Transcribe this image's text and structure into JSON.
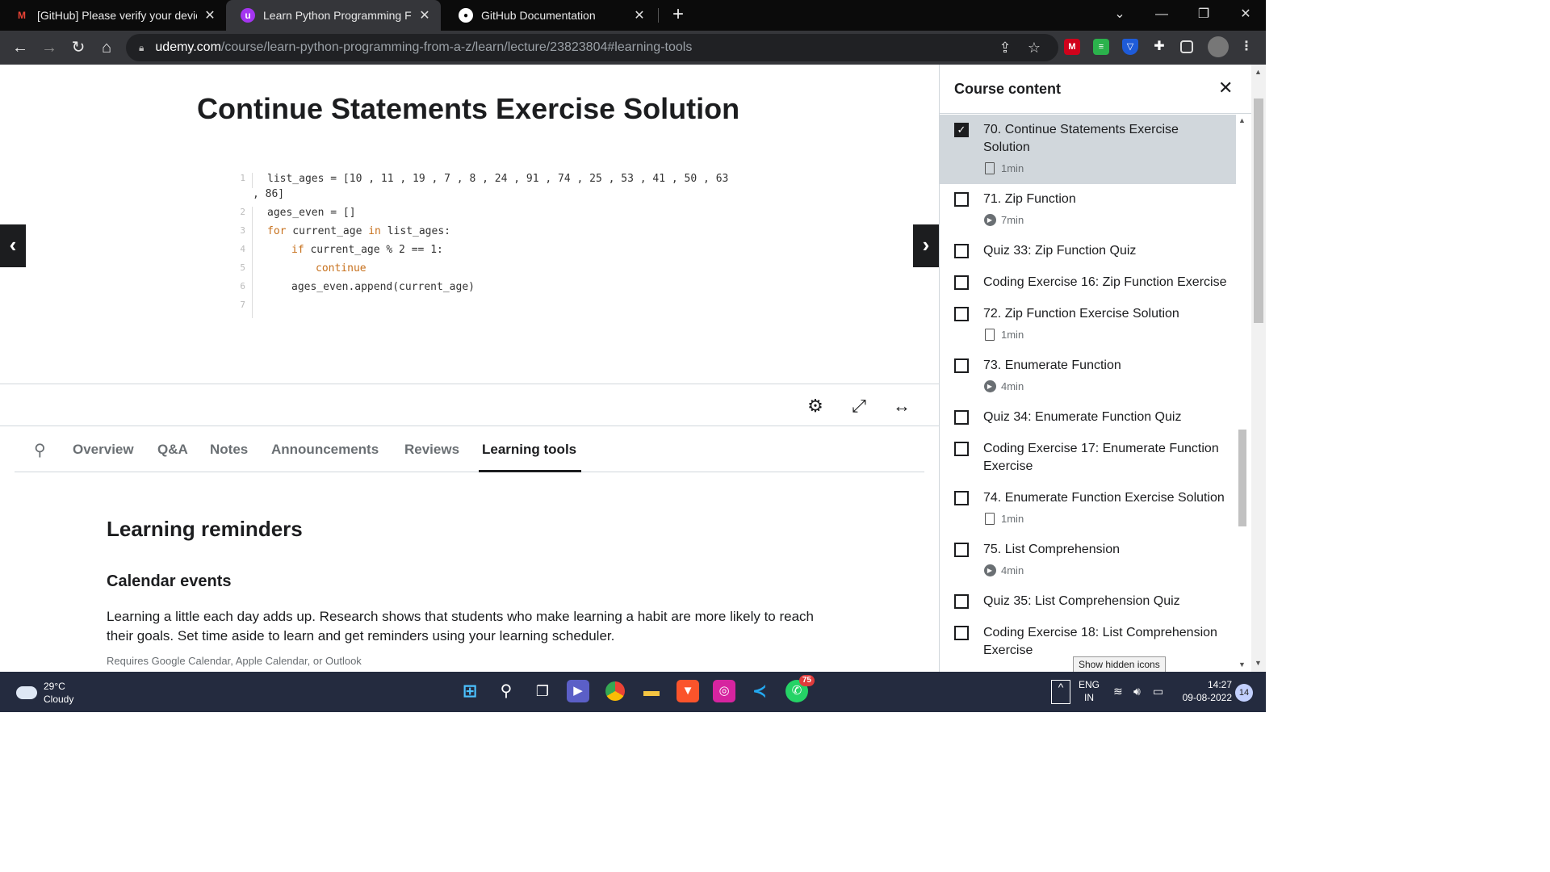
{
  "browser": {
    "tabs": [
      {
        "title": "[GitHub] Please verify your device",
        "icon": "gmail-icon"
      },
      {
        "title": "Learn Python Programming From A-Z",
        "icon": "udemy-icon"
      },
      {
        "title": "GitHub Documentation",
        "icon": "github-icon"
      }
    ],
    "url_host": "udemy.com",
    "url_path": "/course/learn-python-programming-from-a-z/learn/lecture/23823804#learning-tools"
  },
  "lecture": {
    "title": "Continue Statements Exercise Solution",
    "code_lines": [
      {
        "n": "1",
        "text": "list_ages = [10 , 11 , 19 , 7 , 8 , 24 , 91 , 74 , 25 , 53 , 41 , 50 , 63",
        "cont": ", 86]"
      },
      {
        "n": "2",
        "text": "ages_even = []"
      },
      {
        "n": "3",
        "kw": "for",
        "text": " current_age ",
        "kw2": "in",
        "text2": " list_ages:"
      },
      {
        "n": "4",
        "indent": 1,
        "kw": "if",
        "text": " current_age % 2 == 1:"
      },
      {
        "n": "5",
        "indent": 2,
        "kw": "continue",
        "text": ""
      },
      {
        "n": "6",
        "indent": 1,
        "text": "ages_even.append(current_age)"
      },
      {
        "n": "7",
        "text": ""
      }
    ]
  },
  "page_tabs": [
    "Overview",
    "Q&A",
    "Notes",
    "Announcements",
    "Reviews",
    "Learning tools"
  ],
  "learning": {
    "heading": "Learning reminders",
    "sub_heading": "Calendar events",
    "paragraph": "Learning a little each day adds up. Research shows that students who make learning a habit are more likely to reach their goals. Set time aside to learn and get reminders using your learning scheduler.",
    "note": "Requires Google Calendar, Apple Calendar, or Outlook"
  },
  "sidebar": {
    "title": "Course content",
    "items": [
      {
        "label": "70. Continue Statements Exercise Solution",
        "meta": "1min",
        "type": "doc",
        "checked": true,
        "active": true
      },
      {
        "label": "71. Zip Function",
        "meta": "7min",
        "type": "video",
        "checked": false
      },
      {
        "label": "Quiz 33: Zip Function Quiz",
        "meta": "",
        "type": "none",
        "checked": false
      },
      {
        "label": "Coding Exercise 16: Zip Function Exercise",
        "meta": "",
        "type": "none",
        "checked": false
      },
      {
        "label": "72. Zip Function Exercise Solution",
        "meta": "1min",
        "type": "doc",
        "checked": false
      },
      {
        "label": "73. Enumerate Function",
        "meta": "4min",
        "type": "video",
        "checked": false
      },
      {
        "label": "Quiz 34: Enumerate Function Quiz",
        "meta": "",
        "type": "none",
        "checked": false
      },
      {
        "label": "Coding Exercise 17: Enumerate Function Exercise",
        "meta": "",
        "type": "none",
        "checked": false
      },
      {
        "label": "74. Enumerate Function Exercise Solution",
        "meta": "1min",
        "type": "doc",
        "checked": false
      },
      {
        "label": "75. List Comprehension",
        "meta": "4min",
        "type": "video",
        "checked": false
      },
      {
        "label": "Quiz 35: List Comprehension Quiz",
        "meta": "",
        "type": "none",
        "checked": false
      },
      {
        "label": "Coding Exercise 18: List Comprehension Exercise",
        "meta": "",
        "type": "none",
        "checked": false
      }
    ]
  },
  "tooltip": "Show hidden icons",
  "taskbar": {
    "temp": "29°C",
    "condition": "Cloudy",
    "lang": "ENG",
    "region": "IN",
    "time": "14:27",
    "date": "09-08-2022",
    "notif_count": "14",
    "whatsapp_badge": "75"
  }
}
